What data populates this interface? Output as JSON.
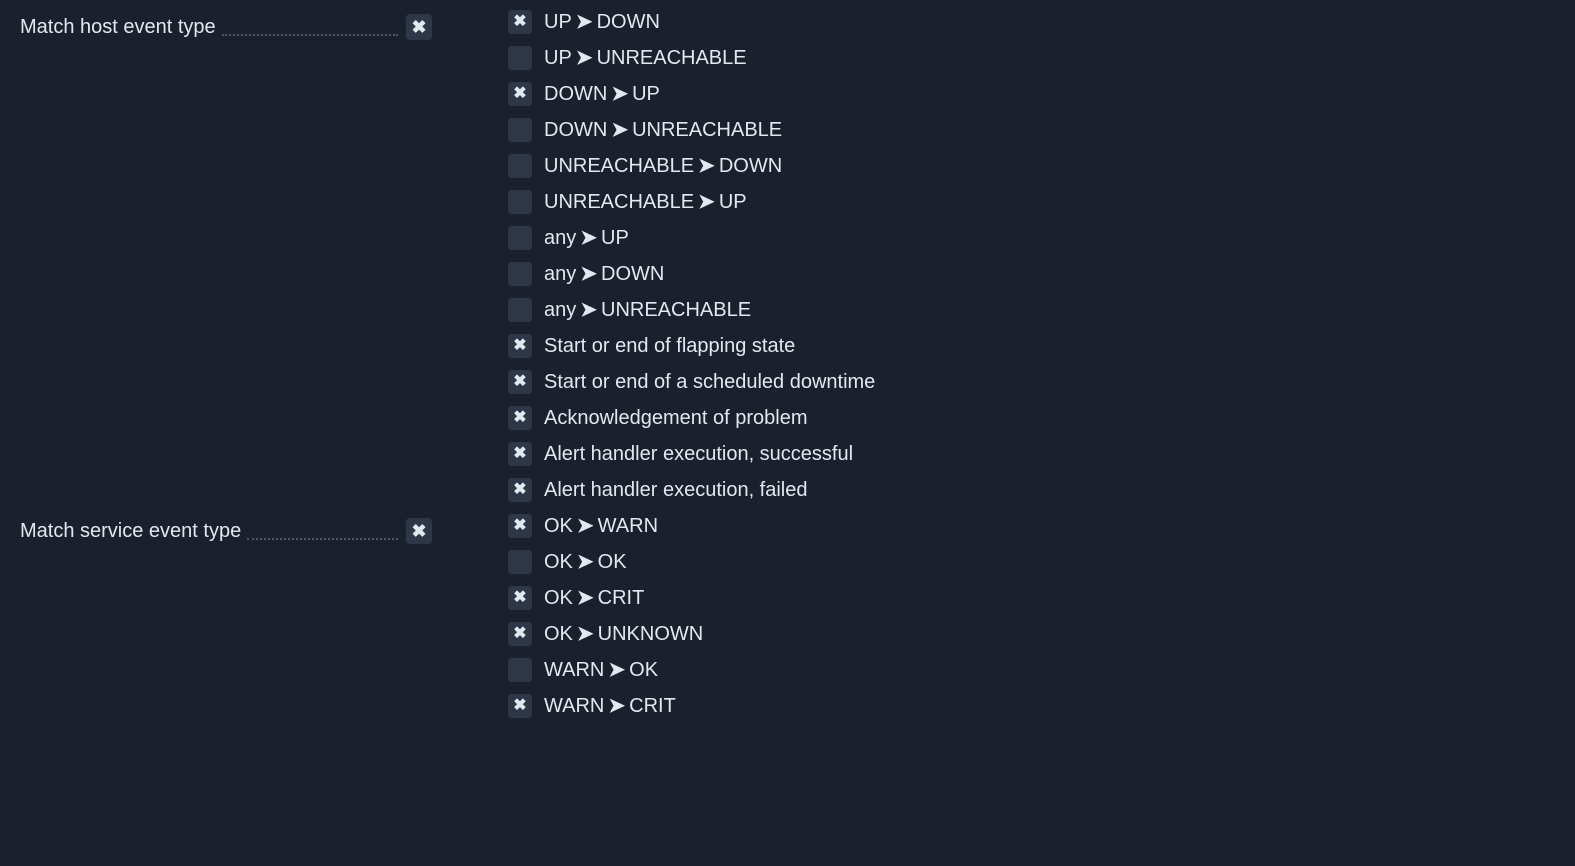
{
  "transition_separator": "➤",
  "sections": [
    {
      "id": "host-event-type",
      "label": "Match host event type",
      "enabled": true,
      "options": [
        {
          "checked": true,
          "type": "transition",
          "from": "UP",
          "to": "DOWN"
        },
        {
          "checked": false,
          "type": "transition",
          "from": "UP",
          "to": "UNREACHABLE"
        },
        {
          "checked": true,
          "type": "transition",
          "from": "DOWN",
          "to": "UP"
        },
        {
          "checked": false,
          "type": "transition",
          "from": "DOWN",
          "to": "UNREACHABLE"
        },
        {
          "checked": false,
          "type": "transition",
          "from": "UNREACHABLE",
          "to": "DOWN"
        },
        {
          "checked": false,
          "type": "transition",
          "from": "UNREACHABLE",
          "to": "UP"
        },
        {
          "checked": false,
          "type": "transition",
          "from": "any",
          "to": "UP"
        },
        {
          "checked": false,
          "type": "transition",
          "from": "any",
          "to": "DOWN"
        },
        {
          "checked": false,
          "type": "transition",
          "from": "any",
          "to": "UNREACHABLE"
        },
        {
          "checked": true,
          "type": "plain",
          "text": "Start or end of flapping state"
        },
        {
          "checked": true,
          "type": "plain",
          "text": "Start or end of a scheduled downtime"
        },
        {
          "checked": true,
          "type": "plain",
          "text": "Acknowledgement of problem"
        },
        {
          "checked": true,
          "type": "plain",
          "text": "Alert handler execution, successful"
        },
        {
          "checked": true,
          "type": "plain",
          "text": "Alert handler execution, failed"
        }
      ]
    },
    {
      "id": "service-event-type",
      "label": "Match service event type",
      "enabled": true,
      "options": [
        {
          "checked": true,
          "type": "transition",
          "from": "OK",
          "to": "WARN"
        },
        {
          "checked": false,
          "type": "transition",
          "from": "OK",
          "to": "OK"
        },
        {
          "checked": true,
          "type": "transition",
          "from": "OK",
          "to": "CRIT"
        },
        {
          "checked": true,
          "type": "transition",
          "from": "OK",
          "to": "UNKNOWN"
        },
        {
          "checked": false,
          "type": "transition",
          "from": "WARN",
          "to": "OK"
        },
        {
          "checked": true,
          "type": "transition",
          "from": "WARN",
          "to": "CRIT"
        }
      ]
    }
  ]
}
